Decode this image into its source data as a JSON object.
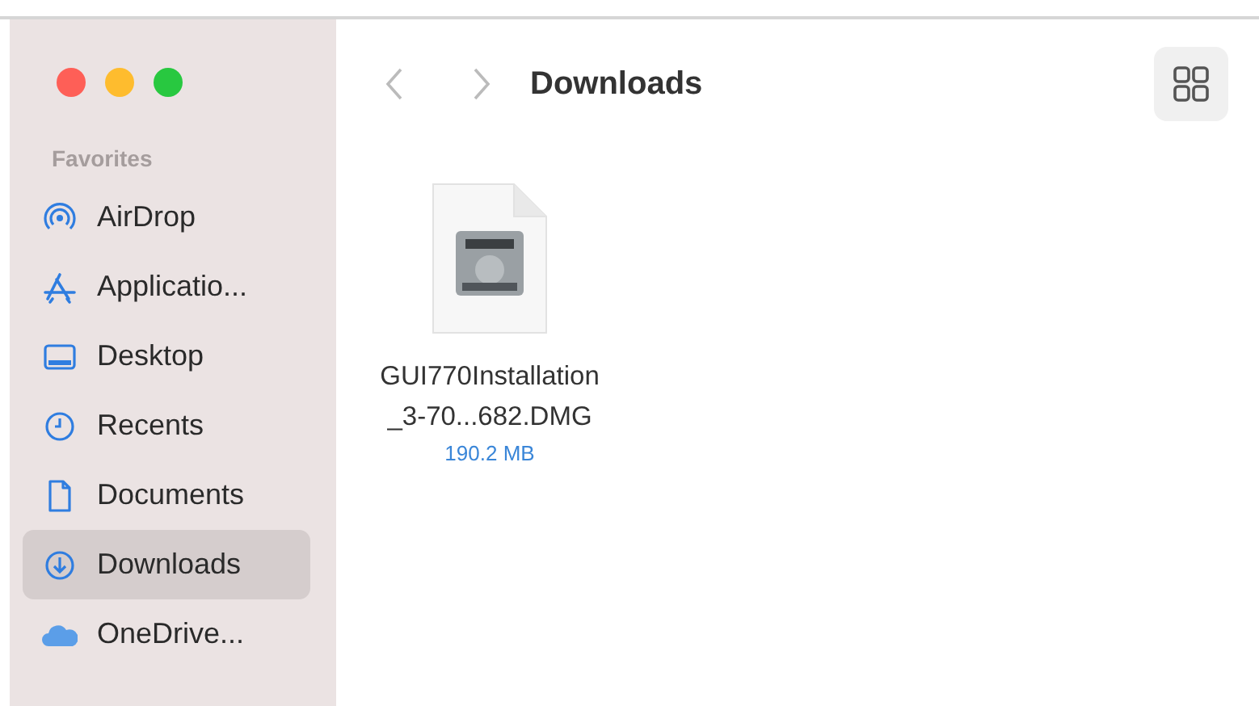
{
  "window": {
    "title": "Downloads"
  },
  "sidebar": {
    "section": "Favorites",
    "items": [
      {
        "label": "AirDrop",
        "kind": "airdrop",
        "selected": false
      },
      {
        "label": "Applicatio...",
        "kind": "apps",
        "selected": false
      },
      {
        "label": "Desktop",
        "kind": "desktop",
        "selected": false
      },
      {
        "label": "Recents",
        "kind": "clock",
        "selected": false
      },
      {
        "label": "Documents",
        "kind": "doc",
        "selected": false
      },
      {
        "label": "Downloads",
        "kind": "download",
        "selected": true
      },
      {
        "label": "OneDrive...",
        "kind": "cloud",
        "selected": false
      }
    ]
  },
  "files": [
    {
      "name": "GUI770Installation_3-70...682.DMG",
      "size": "190.2 MB",
      "kind": "disk-image"
    }
  ]
}
